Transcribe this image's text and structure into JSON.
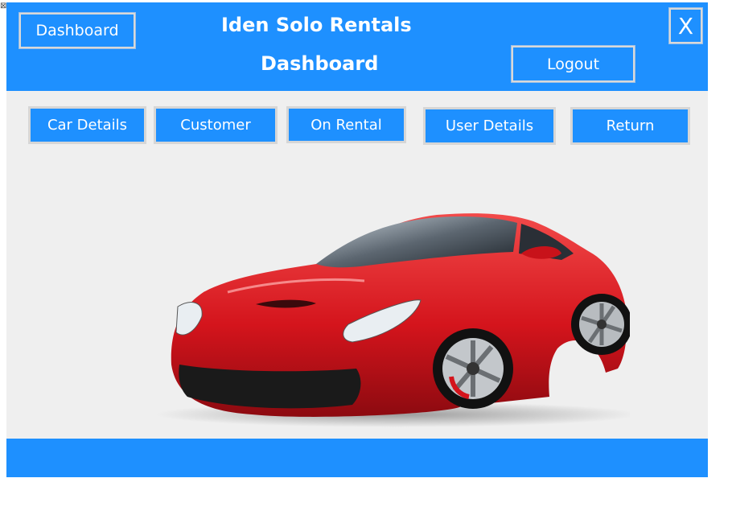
{
  "window": {
    "corner_icon": "close-glyph",
    "corner_glyph": "⊠"
  },
  "header": {
    "app_title": "Iden Solo Rentals",
    "page_title": "Dashboard",
    "dashboard_button": "Dashboard",
    "logout_button": "Logout",
    "close_button": "X"
  },
  "nav": {
    "items": [
      {
        "label": "Car Details"
      },
      {
        "label": "Customer"
      },
      {
        "label": "On Rental"
      },
      {
        "label": "User Details"
      },
      {
        "label": "Return"
      }
    ]
  },
  "colors": {
    "accent": "#1e90ff",
    "background": "#efefef",
    "car": "#d4141c"
  },
  "main": {
    "image": "red-sports-car"
  }
}
